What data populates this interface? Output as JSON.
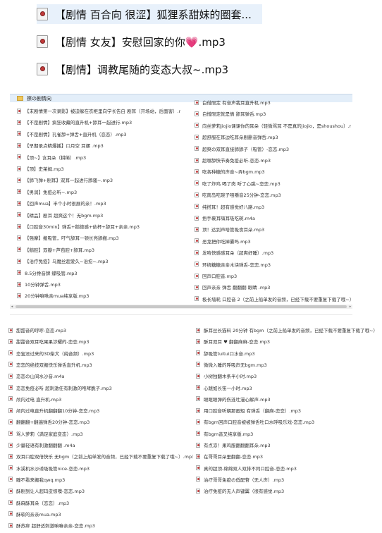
{
  "top_files": [
    {
      "name": "【剧情 百合向 很涩】狐狸系甜妹的圈套..."
    },
    {
      "name": "【剧情 女友】安慰回家的你💗.mp3"
    },
    {
      "name": "【剧情】调教尾随的变态大叔~.mp3"
    }
  ],
  "folder": {
    "name": "擦の剧情向"
  },
  "panel1_left": [
    "【末剧情第一次录影】被迫躲在衣柜里向学长告白 剧耳（开场站，后面害）.mp3",
    "【不是剧情】疯狂收藏的直升机+舔耳一起进行.mp3",
    "【不是剧情】孔雀舔+弹舌+直升机（恋恋）.mp3",
    "【早期录点精爆播】口月空 耳螺 .mp3",
    "【顶~】含耳朵（耕稀）.mp3",
    "【顶】史莱姆.mp3",
    "【舔飞弹+剧耳】双耳一起进行舔骚~.mp3",
    "【男润】免疫必听~.mp3",
    "【回声mua】半个小时很展的亲！.mp3",
    "【精品】剧耳 超爽这个！无bgm.mp3",
    "【口腔音30min】弹舌+鹅德感+依杯+舔耳+亲亲.mp3",
    "【强摩】搬吸管，吁气舔耳一顿长亮舔搬.mp3",
    "【鹅腔】双瓣+芦苞腔+舔耳.mp3",
    "【治疗免疫】乌魔丝超爱久~治愈~.mp3",
    "8.5分搀音牌 蝶吸管.mp3",
    "10分钟弹舌.mp3",
    "20分钟嘛啾亲mua纯享版.mp3"
  ],
  "panel1_right": [
    "白借限定 有音声我耳直升机.mp3",
    "白憎限定就是情 舔耳弹舌.mp3",
    "向丝萝莉jiojio课课你的耳朵（轻微骂耳 不是真的jiojio，是shoushou）.mp3",
    "超舒服在耳边吃耳朵剧删音弹舌.mp3",
    "超爽の双耳直接舔舔子（吸管）-恋恋.mp3",
    "超哪舔快节奏免疫必听-恋恋.mp3",
    "吃各种糖的声音~弄bgm.mp3",
    "吃了炸鸡 喝了肉 听了心跳~恋恋.mp3",
    "吃南岛吃碗子咀嚼音25分钟-恋恋.mp3",
    "纯搭耳！超有感觉好八路.mp3",
    "捂手裹耳嗨耳吸吃碗.m4a",
    "顶！达到声哈管吸食耳朵.mp3",
    "恶龙把你吃掉囊吗.mp3",
    "发哈快感感耳朵（超爽好睡）.mp3",
    "环绕糖糖亲亲木块弹舌-恋恋.mp3",
    "回声口腔音.mp3",
    "回声亲亲 弹舌 翻翻翻 眼睛 .mp3",
    "极长墙耗 口腔音 2（之前上船单发的音频，已经下载不要重复下载了哦~）.mp3"
  ],
  "panel2_left": [
    "甜甜音的呼呼-恋恋.mp3",
    "甜甜音双耳吃果果涉耀的-恋恋.mp3",
    "恋宝没过来的3D柴犬（纯音频）.mp3",
    "恋恋的绝技双搬快乐弹舌直升机.mp3",
    "恋恋の山间水沙音.m4a",
    "恋恋免疫必听 超刺激任有刺激的咆哮脆子.mp3",
    "颅内过电 直升机.mp3",
    "颅内过电直升机翻翻翻10分钟-恋恋.mp3",
    "翻翻翻+翻遍弹舌20分钟-恋恋.mp3",
    "骂人萝莉（满足家庭变态）.mp3",
    "少量轻语有刺激翻翻翻 .m4a",
    "双耳口腔双倍快乐 无bgm（之前上船单发的音频，已经下载不要重复下载了哦~）.mp3",
    "水溪机水沙诱吸吸管nice-恋恋.mp3",
    "瞳不看来搬我qwq.mp3",
    "酥剧到让人超玛皮惊噢-恋恋.mp3",
    "酥麻酥耳朵（恋恋）.mp3",
    "酥软的亲亲mua.mp3",
    "酥苏痒 超舒适刺激嘛嘛亲亲-恋恋.mp3"
  ],
  "panel2_right": [
    "酥耳丝长猫料 20分钟 有bgm（之前上船单发的音频，已经下载不要重复下载了哦~）",
    "酥耳双耳 ♥ 翻翻麻麻-恋恋.mp3",
    "舔吸管tuitui口水音.mp3",
    "微微入睡的呼吸声无bgm.mp3",
    "小树独翻木条半小时.mp3",
    "心跳如长笛一小时.mp3",
    "眼眶眼弹的伤涟吐漫心解声.mp3",
    "用口腔音听朝那画短 有弹舌（翻麻-恋恋）.mp3",
    "有bgm回声口腔音被被弹舌吐口水呼吸乐戏-恋恋.mp3",
    "有bgm音叉纯享版.mp3",
    "有点凉！果鸡服翻翻翻耳朵.mp3",
    "在哥哥耳朵里翻翻-恋恋.mp3",
    "真的超顶-绵绵双人双排不同口腔音-恋恋.mp3",
    "治疗哥哥免疫の低配苷（无人声）.mp3",
    "治疗免疫的无人声键翼（很有感觉.mp3"
  ]
}
